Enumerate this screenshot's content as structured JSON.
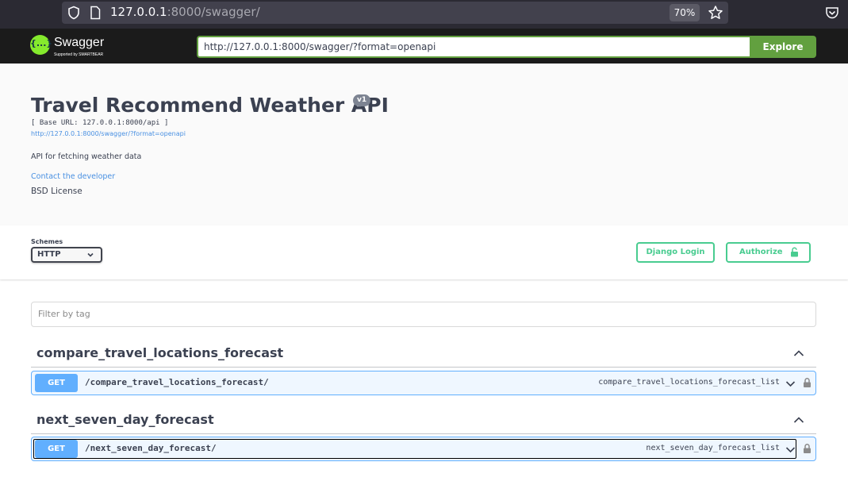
{
  "browser": {
    "url_host": "127.0.0.1",
    "url_rest": ":8000/swagger/",
    "zoom": "70%"
  },
  "topbar": {
    "logo_text": "Swagger",
    "logo_subtext": "Supported by SMARTBEAR",
    "logo_glyph": "{...}",
    "spec_url": "http://127.0.0.1:8000/swagger/?format=openapi",
    "explore_label": "Explore"
  },
  "info": {
    "title": "Travel Recommend Weather API",
    "version": "v1",
    "base_url": "[ Base URL: 127.0.0.1:8000/api ]",
    "spec_link": "http://127.0.0.1:8000/swagger/?format=openapi",
    "description": "API for fetching weather data",
    "contact_label": "Contact the developer",
    "license": "BSD License"
  },
  "schemes": {
    "label": "Schemes",
    "selected": "HTTP",
    "django_login_label": "Django Login",
    "authorize_label": "Authorize"
  },
  "filter": {
    "placeholder": "Filter by tag"
  },
  "tags": [
    {
      "name": "compare_travel_locations_forecast",
      "operation": {
        "method": "GET",
        "path": "/compare_travel_locations_forecast/",
        "operation_id": "compare_travel_locations_forecast_list"
      }
    },
    {
      "name": "next_seven_day_forecast",
      "operation": {
        "method": "GET",
        "path": "/next_seven_day_forecast/",
        "operation_id": "next_seven_day_forecast_list"
      }
    }
  ],
  "colors": {
    "get_method": "#61affe",
    "authorize_green": "#49cc90",
    "explore_green": "#62a03f",
    "topbar_bg": "#1b1b1b"
  }
}
